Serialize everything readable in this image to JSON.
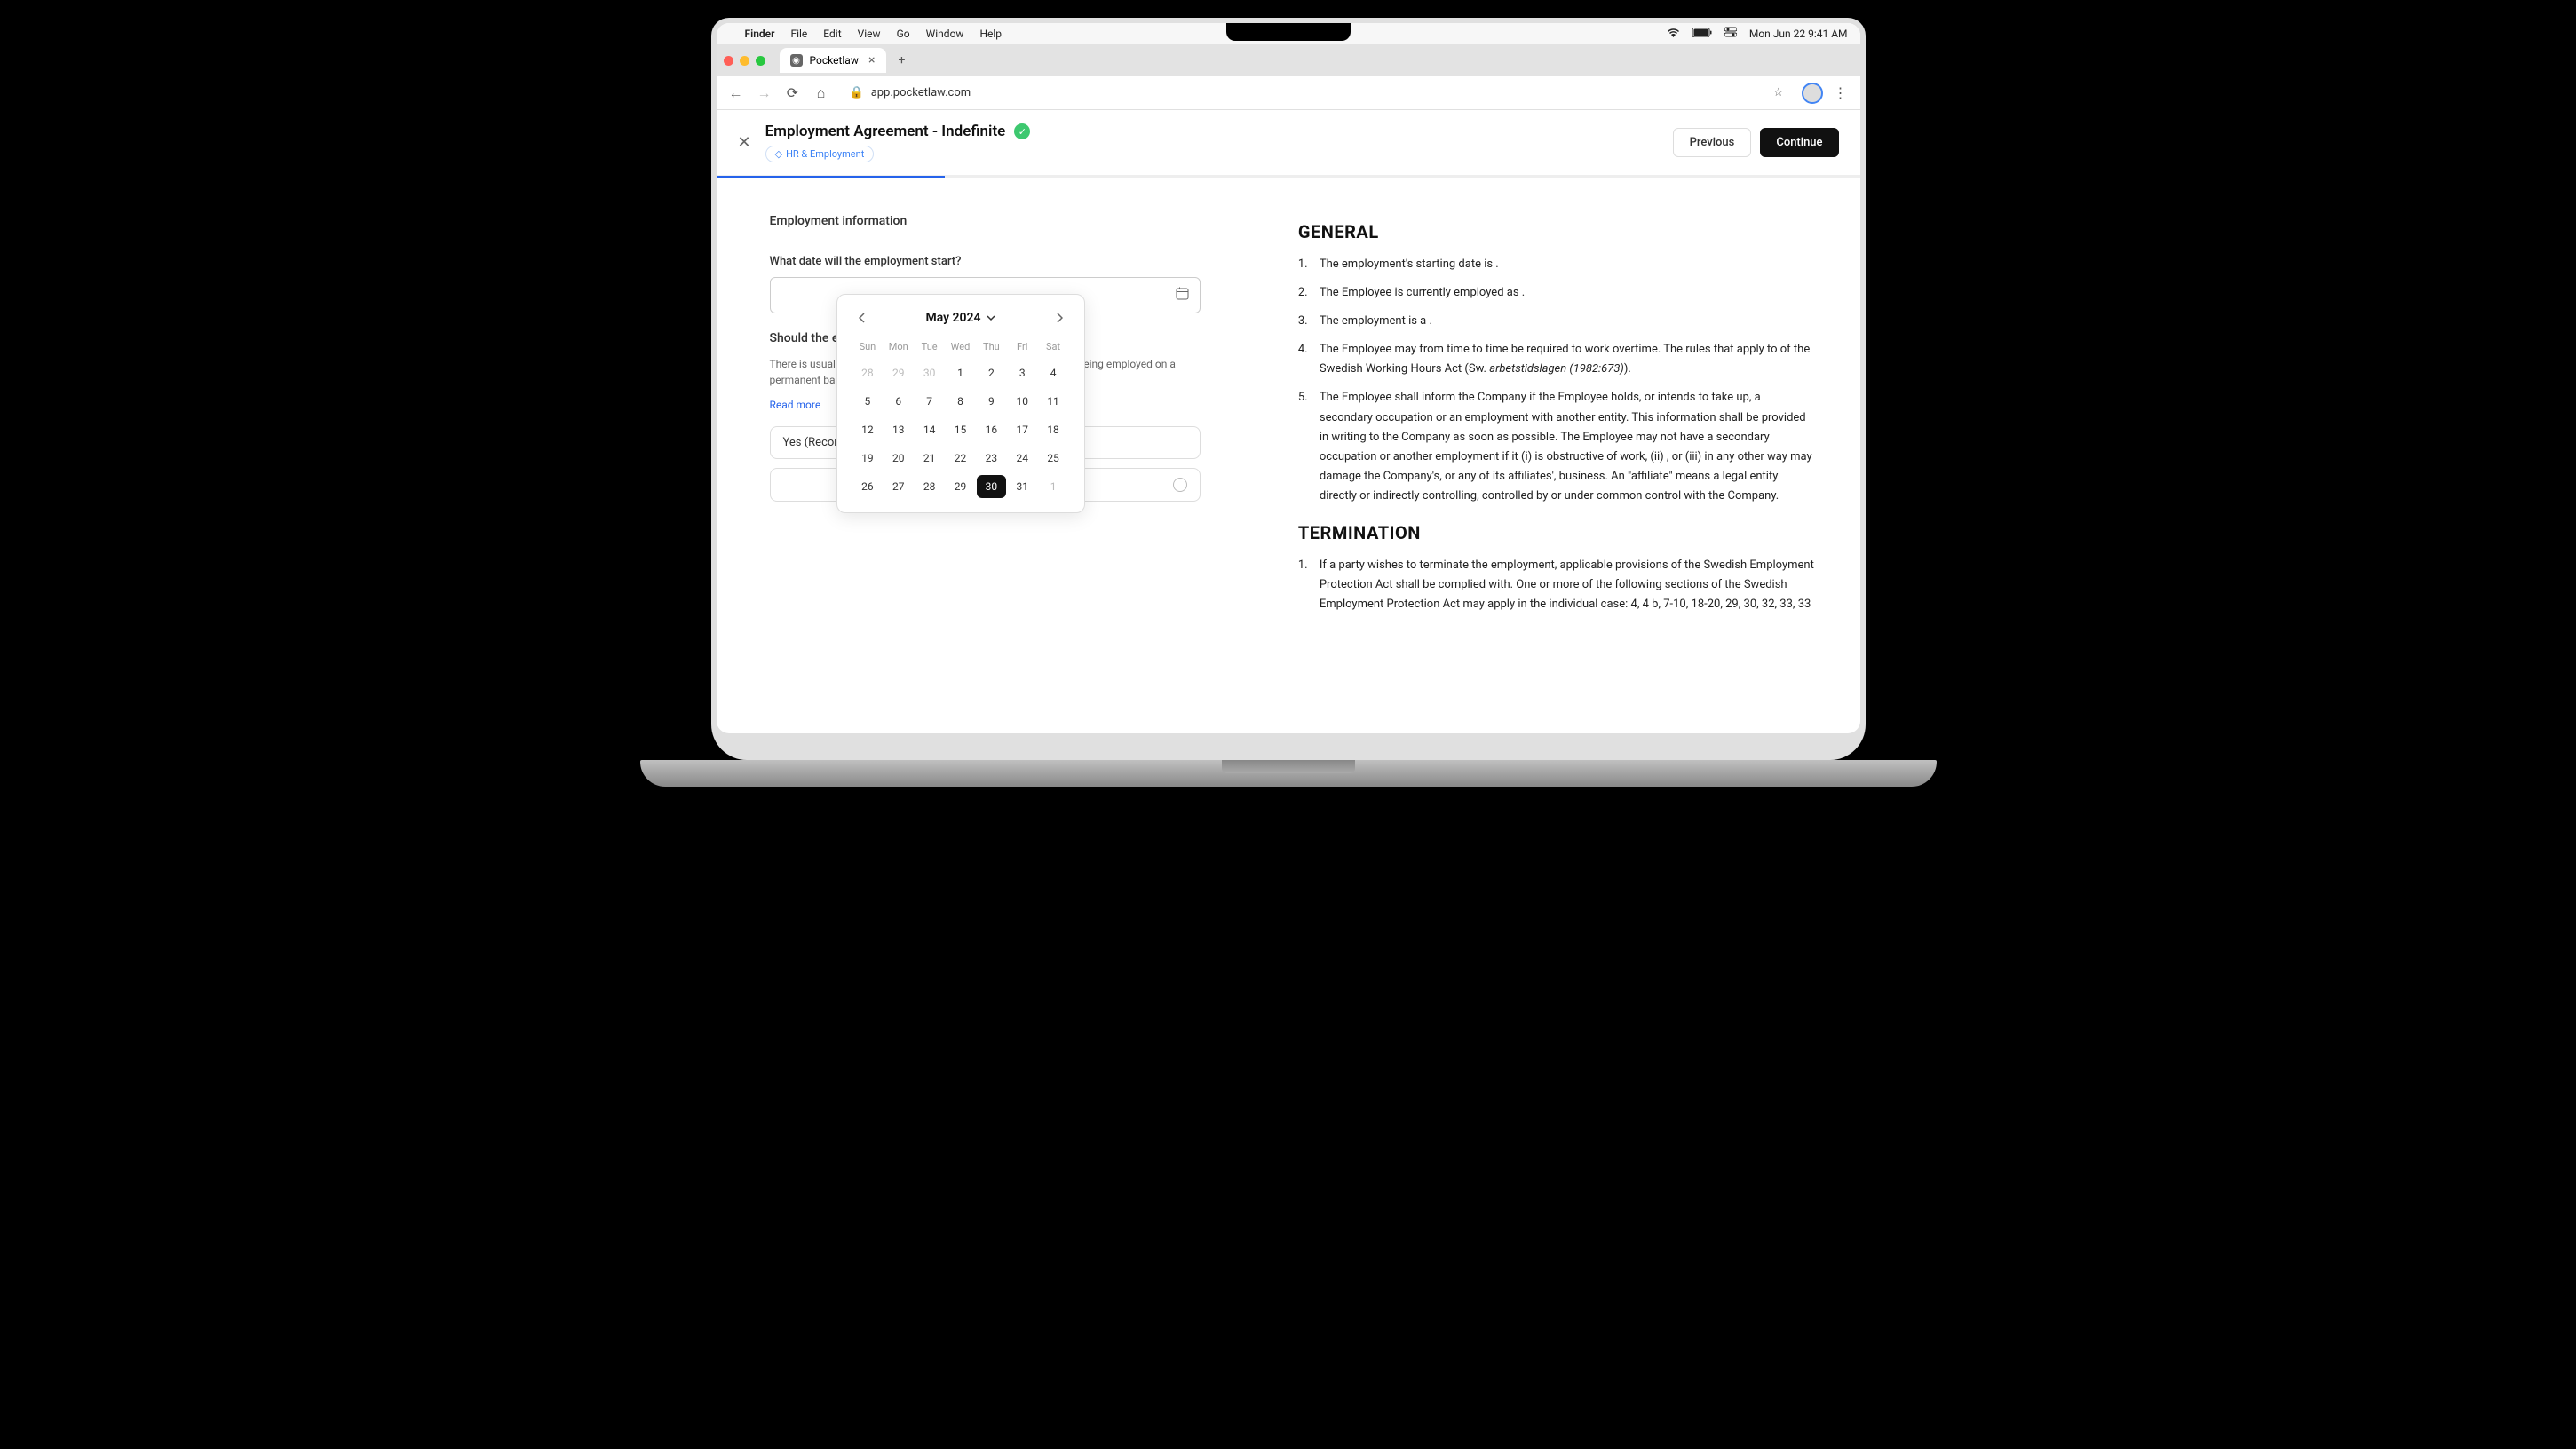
{
  "menubar": {
    "app": "Finder",
    "items": [
      "File",
      "Edit",
      "View",
      "Go",
      "Window",
      "Help"
    ],
    "datetime": "Mon Jun 22  9:41 AM"
  },
  "browser": {
    "tab_title": "Pocketlaw",
    "url": "app.pocketlaw.com"
  },
  "header": {
    "title": "Employment Agreement - Indefinite",
    "tag": "HR & Employment",
    "previous": "Previous",
    "continue": "Continue"
  },
  "form": {
    "section": "Employment information",
    "q1_label": "What date will the employment start?",
    "q2_label": "Should the empl",
    "q2_hint_prefix": "There is usually a nee",
    "q2_hint_suffix": "being employed on a permanent basis. Suc",
    "read_more": "Read more",
    "option_yes": "Yes (Recommen"
  },
  "calendar": {
    "month": "May 2024",
    "daynames": [
      "Sun",
      "Mon",
      "Tue",
      "Wed",
      "Thu",
      "Fri",
      "Sat"
    ],
    "weeks": [
      [
        {
          "d": "28",
          "o": true
        },
        {
          "d": "29",
          "o": true
        },
        {
          "d": "30",
          "o": true
        },
        {
          "d": "1"
        },
        {
          "d": "2"
        },
        {
          "d": "3"
        },
        {
          "d": "4"
        }
      ],
      [
        {
          "d": "5"
        },
        {
          "d": "6"
        },
        {
          "d": "7"
        },
        {
          "d": "8"
        },
        {
          "d": "9"
        },
        {
          "d": "10"
        },
        {
          "d": "11"
        }
      ],
      [
        {
          "d": "12"
        },
        {
          "d": "13"
        },
        {
          "d": "14"
        },
        {
          "d": "15"
        },
        {
          "d": "16"
        },
        {
          "d": "17"
        },
        {
          "d": "18"
        }
      ],
      [
        {
          "d": "19"
        },
        {
          "d": "20"
        },
        {
          "d": "21"
        },
        {
          "d": "22"
        },
        {
          "d": "23"
        },
        {
          "d": "24"
        },
        {
          "d": "25"
        }
      ],
      [
        {
          "d": "26"
        },
        {
          "d": "27"
        },
        {
          "d": "28"
        },
        {
          "d": "29"
        },
        {
          "d": "30",
          "sel": true
        },
        {
          "d": "31"
        },
        {
          "d": "1",
          "o": true
        }
      ]
    ]
  },
  "document": {
    "heading1": "GENERAL",
    "items1": [
      "The employment's starting date is .",
      "The Employee is currently employed as .",
      "The employment is a ."
    ],
    "item4_a": "The Employee may from time to time be required to work overtime. The rules that apply to of the Swedish Working Hours Act (Sw. ",
    "item4_em": "arbetstidslagen (1982:673)",
    "item4_b": ").",
    "item5_a": "The Employee shall inform the Company if the Employee holds, or intends to take up, a secondary occupation or an employment with another entity. This information shall be provided in writing to the Company as soon as possible. The Employee may not have a secondary occupation or another employment if it (i) is obstructive of work, (ii) , or (iii) in any other way may damage the Company's, or any of its affiliates', business. An \"",
    "item5_aff": "affiliate",
    "item5_b": "\" means a legal entity directly or indirectly controlling, controlled by or under common control with the Company.",
    "heading2": "TERMINATION",
    "term1": "If a party wishes to terminate the employment, applicable provisions of the Swedish Employment Protection Act shall be complied with. One or more of the following sections of the Swedish Employment Protection Act may apply in the individual case: 4, 4 b, 7-10, 18-20, 29, 30, 32, 33, 33"
  }
}
